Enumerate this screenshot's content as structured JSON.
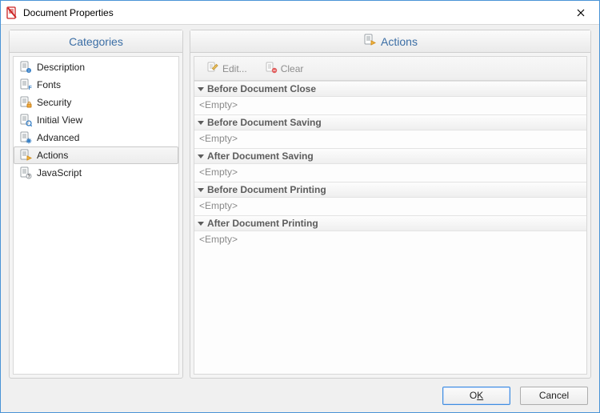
{
  "window": {
    "title": "Document Properties"
  },
  "headers": {
    "categories": "Categories",
    "actions": "Actions"
  },
  "categories": [
    {
      "id": "description",
      "label": "Description",
      "icon": "desc"
    },
    {
      "id": "fonts",
      "label": "Fonts",
      "icon": "fonts"
    },
    {
      "id": "security",
      "label": "Security",
      "icon": "security"
    },
    {
      "id": "initial-view",
      "label": "Initial View",
      "icon": "initial"
    },
    {
      "id": "advanced",
      "label": "Advanced",
      "icon": "advanced"
    },
    {
      "id": "actions",
      "label": "Actions",
      "icon": "actions",
      "selected": true
    },
    {
      "id": "javascript",
      "label": "JavaScript",
      "icon": "js"
    }
  ],
  "toolbar": {
    "edit": "Edit...",
    "clear": "Clear"
  },
  "events": [
    {
      "title": "Before Document Close",
      "body": "<Empty>"
    },
    {
      "title": "Before Document Saving",
      "body": "<Empty>"
    },
    {
      "title": "After Document Saving",
      "body": "<Empty>"
    },
    {
      "title": "Before Document Printing",
      "body": "<Empty>"
    },
    {
      "title": "After Document Printing",
      "body": "<Empty>"
    }
  ],
  "buttons": {
    "ok_pre": "O",
    "ok_u": "K",
    "ok_post": "",
    "cancel": "Cancel"
  }
}
